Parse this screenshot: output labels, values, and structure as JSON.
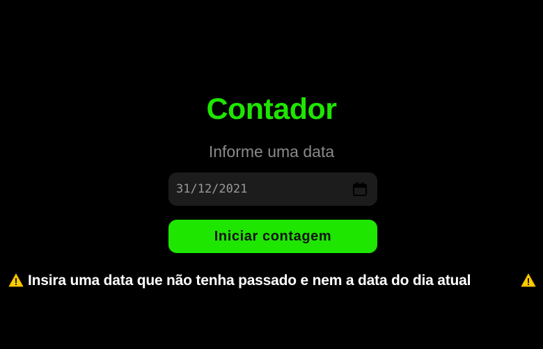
{
  "page": {
    "title": "Contador",
    "subtitle": "Informe uma data"
  },
  "date_input": {
    "value": "31/12/2021",
    "icon": "calendar-icon"
  },
  "start_button": {
    "label": "Iniciar contagem"
  },
  "warning": {
    "text": "Insira uma data que não tenha passado e nem a data do dia atual",
    "icon": "warning-icon"
  },
  "colors": {
    "background": "#000000",
    "accent": "#1ee600",
    "subtitle": "#8a8a8a",
    "input_background": "#1c1c1c",
    "warning_text": "#ffffff",
    "warning_icon": "#ffcc00"
  }
}
